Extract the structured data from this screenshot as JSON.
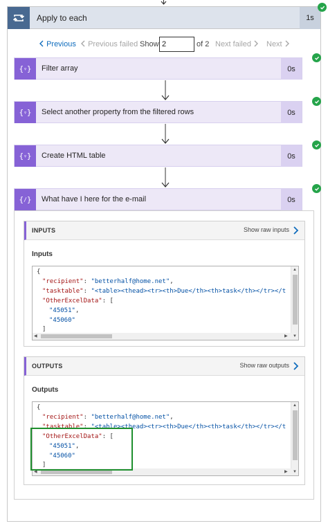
{
  "foreach": {
    "title": "Apply to each",
    "duration": "1s"
  },
  "pager": {
    "previous": "Previous",
    "previous_failed": "Previous failed",
    "show": "Show",
    "current": "2",
    "of": "of 2",
    "next_failed": "Next failed",
    "next": "Next"
  },
  "actions": [
    {
      "title": "Filter array",
      "duration": "0s",
      "icon": "filter-icon"
    },
    {
      "title": "Select another property from the filtered rows",
      "duration": "0s",
      "icon": "select-icon"
    },
    {
      "title": "Create HTML table",
      "duration": "0s",
      "icon": "table-icon"
    },
    {
      "title": "What have I here for the e-mail",
      "duration": "0s",
      "icon": "compose-icon"
    }
  ],
  "inputs": {
    "header": "INPUTS",
    "raw_link": "Show raw inputs",
    "label": "Inputs",
    "lines": [
      {
        "open": "{"
      },
      {
        "key": "\"recipient\"",
        "sep": ": ",
        "val": "\"betterhalf@home.net\"",
        "tail": ","
      },
      {
        "key": "\"tasktable\"",
        "sep": ": ",
        "val": "\"<table><thead><tr><th>Due</th><th>task</th></tr></t",
        "tail": ""
      },
      {
        "key": "\"OtherExcelData\"",
        "sep": ": ",
        "val": "",
        "tail": "["
      },
      {
        "val": "\"45051\"",
        "tail": ","
      },
      {
        "val": "\"45060\"",
        "tail": ""
      },
      {
        "open": "]"
      }
    ]
  },
  "outputs": {
    "header": "OUTPUTS",
    "raw_link": "Show raw outputs",
    "label": "Outputs",
    "lines": [
      {
        "open": "{"
      },
      {
        "key": "\"recipient\"",
        "sep": ": ",
        "val": "\"betterhalf@home.net\"",
        "tail": ","
      },
      {
        "key": "\"tasktable\"",
        "sep": ": ",
        "val": "\"<table><thead><tr><th>Due</th><th>task</th></tr></t",
        "tail": ""
      },
      {
        "key": "\"OtherExcelData\"",
        "sep": ": ",
        "val": "",
        "tail": "["
      },
      {
        "val": "\"45051\"",
        "tail": ","
      },
      {
        "val": "\"45060\"",
        "tail": ""
      },
      {
        "open": "]"
      }
    ]
  },
  "colors": {
    "success": "#25a44a",
    "action_accent": "#8662d6",
    "foreach_accent": "#486991",
    "highlight": "#1e8f2d",
    "link": "#0f6cbd"
  }
}
